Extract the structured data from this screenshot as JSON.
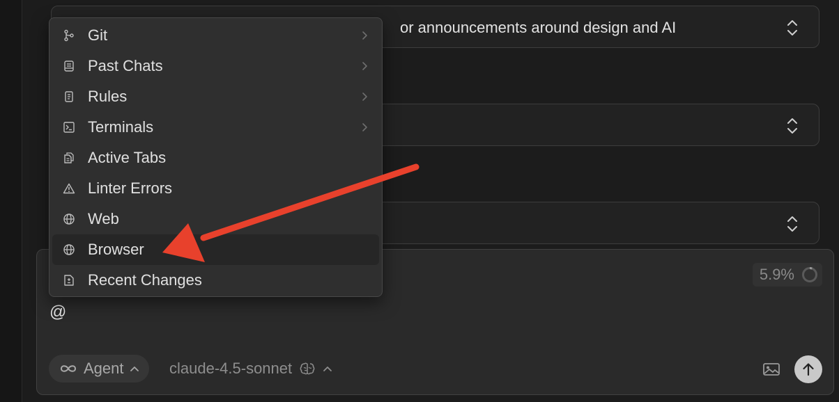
{
  "settings": {
    "field1_value": "or announcements around design and AI",
    "field2_value": "",
    "field3_value": ""
  },
  "menu": {
    "items": [
      {
        "label": "Git",
        "icon": "git-branch-icon",
        "has_submenu": true
      },
      {
        "label": "Past Chats",
        "icon": "chat-history-icon",
        "has_submenu": true
      },
      {
        "label": "Rules",
        "icon": "rules-document-icon",
        "has_submenu": true
      },
      {
        "label": "Terminals",
        "icon": "terminal-icon",
        "has_submenu": true
      },
      {
        "label": "Active Tabs",
        "icon": "files-icon",
        "has_submenu": false
      },
      {
        "label": "Linter Errors",
        "icon": "warning-icon",
        "has_submenu": false
      },
      {
        "label": "Web",
        "icon": "globe-icon",
        "has_submenu": false
      },
      {
        "label": "Browser",
        "icon": "globe-icon",
        "has_submenu": false,
        "highlighted": true
      },
      {
        "label": "Recent Changes",
        "icon": "diff-file-icon",
        "has_submenu": false
      }
    ]
  },
  "composer": {
    "input_text": "@",
    "context_usage": "5.9%",
    "mode_label": "Agent",
    "mode_icon": "infinity-icon",
    "model_label": "claude-4.5-sonnet",
    "model_icon": "brain-icon"
  },
  "annotation": {
    "arrow_color": "#e8412c"
  },
  "colors": {
    "background": "#1c1c1c",
    "menu_bg": "#2f2f2f",
    "composer_bg": "#2a2a2a",
    "send_button": "#c9c9c9"
  }
}
